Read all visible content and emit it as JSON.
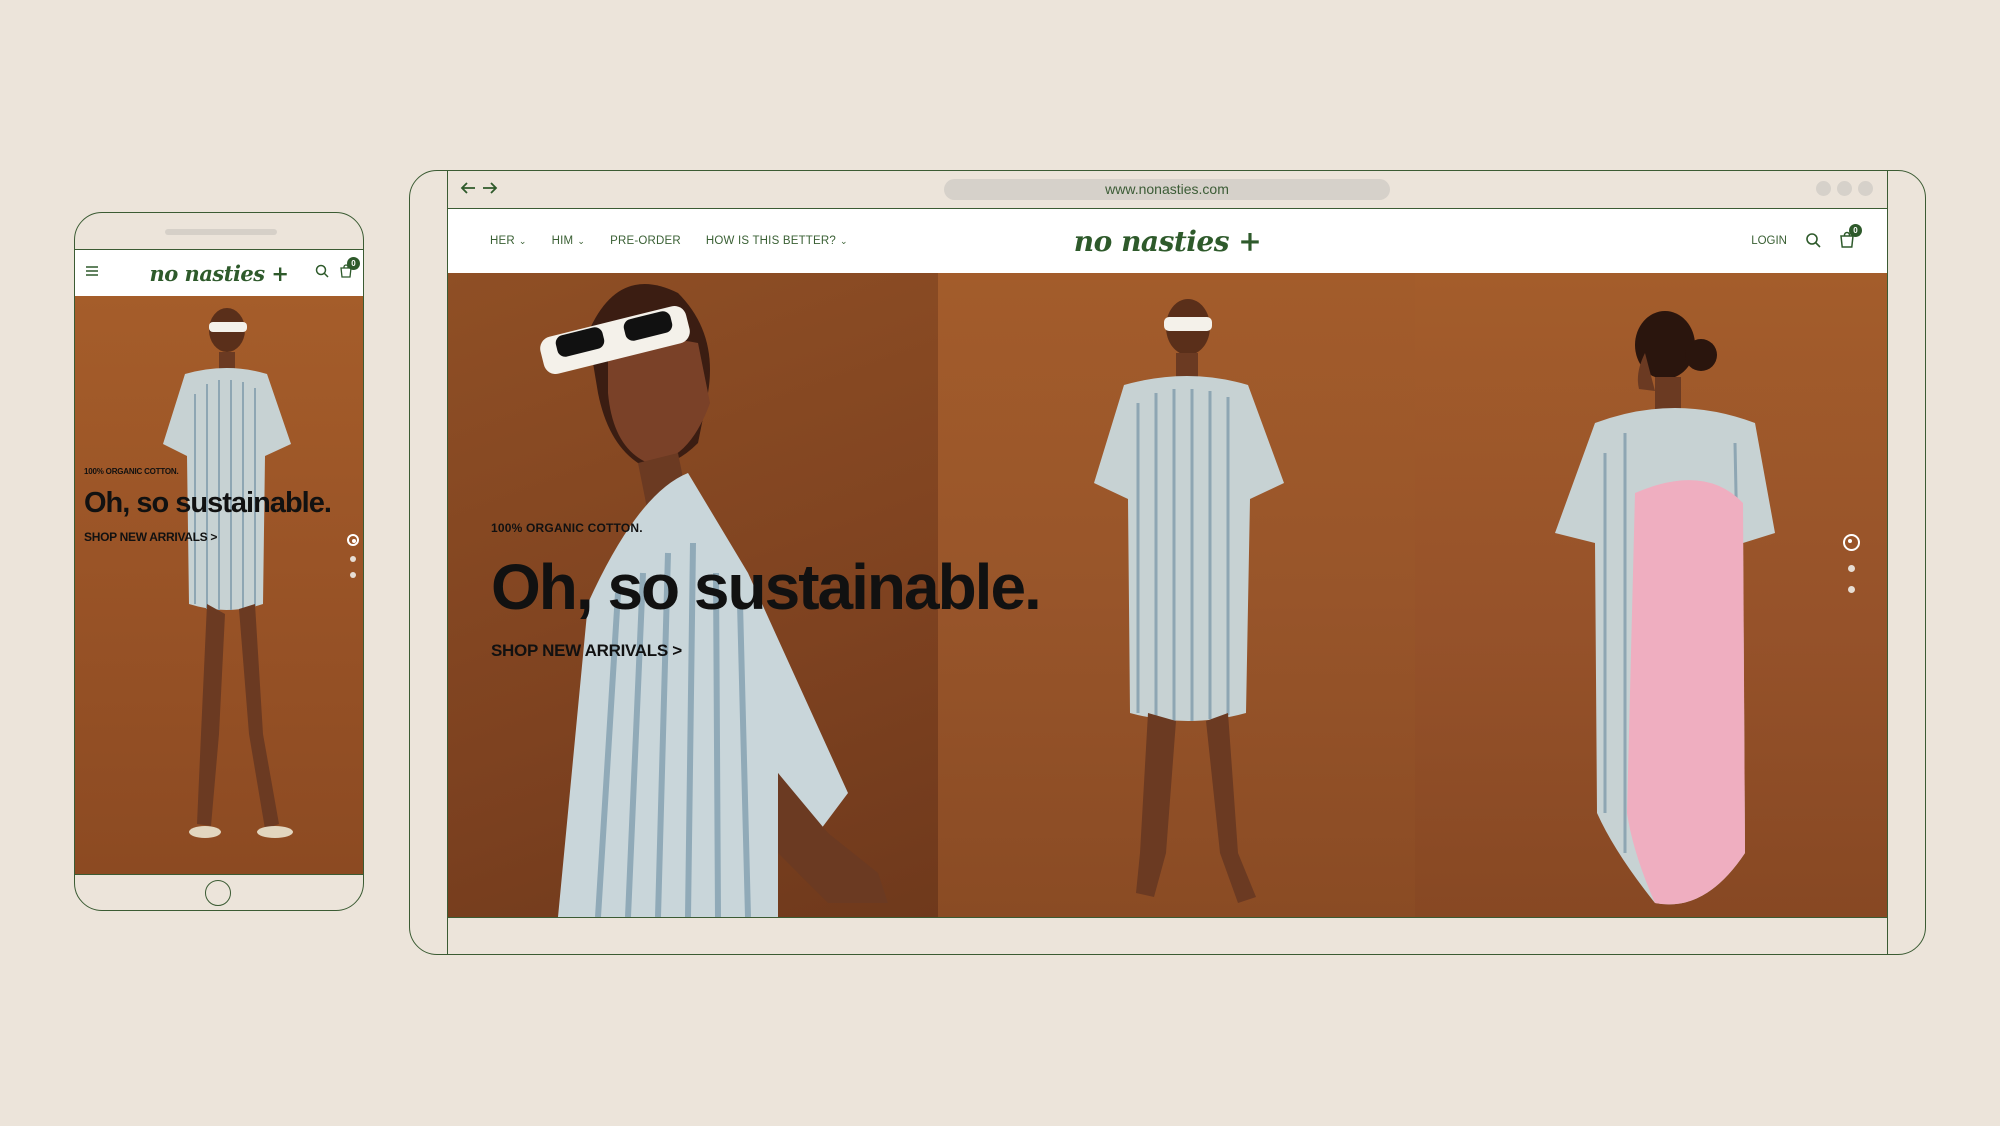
{
  "browser": {
    "url": "www.nonasties.com"
  },
  "brand": {
    "logo": "no nasties +",
    "color": "#2e5a2b"
  },
  "nav": {
    "items": [
      {
        "label": "HER",
        "dropdown": true
      },
      {
        "label": "HIM",
        "dropdown": true
      },
      {
        "label": "PRE-ORDER",
        "dropdown": false
      },
      {
        "label": "HOW IS THIS BETTER?",
        "dropdown": true
      }
    ],
    "login": "LOGIN",
    "cart_count": "0"
  },
  "hero": {
    "eyebrow": "100% ORGANIC COTTON.",
    "title": "Oh, so sustainable.",
    "cta": "SHOP NEW ARRIVALS >",
    "slides_total": 3,
    "active_slide": 1
  },
  "mobile": {
    "cart_count": "0",
    "eyebrow": "100% ORGANIC COTTON.",
    "title": "Oh, so sustainable.",
    "cta": "SHOP NEW ARRIVALS >"
  },
  "icons": {
    "back": "arrow-left-icon",
    "forward": "arrow-right-icon",
    "search": "search-icon",
    "cart": "cart-icon",
    "menu": "hamburger-icon"
  }
}
